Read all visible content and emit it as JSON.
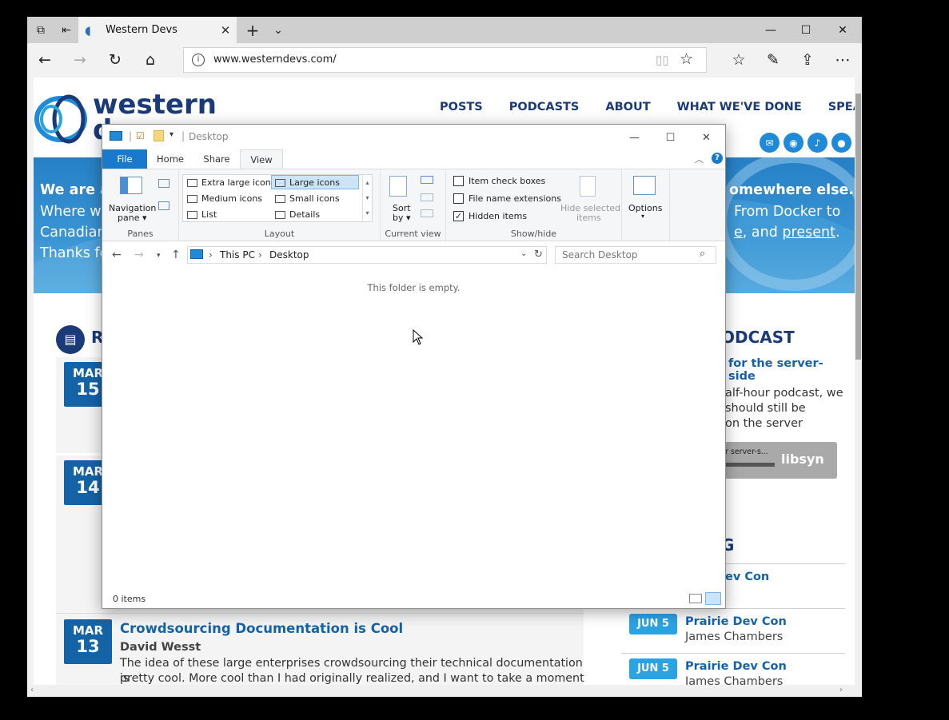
{
  "browser": {
    "tab_title": "Western Devs",
    "url": "www.westerndevs.com/",
    "new_tab": "+",
    "tab_list": "⌄"
  },
  "site": {
    "logo_line1": "western",
    "logo_line2": "devs",
    "menu": [
      "POSTS",
      "PODCASTS",
      "ABOUT",
      "WHAT WE'VE DONE",
      "SPEAKING"
    ],
    "banner": {
      "line1_bold": "We are a",
      "line1_end": "omewhere else.",
      "line2_start": "Where we",
      "line2_end": "From Docker to",
      "line3_start": "Canadian",
      "line3_mid": "e",
      "line3_and": ", and ",
      "line3_link": "present",
      "line3_dot": ".",
      "line4_start": "Thanks for"
    },
    "recent_head": "RE",
    "podcast_head": "ODCAST",
    "podcast_title": "for the server-side",
    "podcast_text": [
      "alf-hour podcast, we",
      "should still be",
      "on the server"
    ],
    "player_label": "r server-s...",
    "player_brand": "libsyn",
    "events_head": "G",
    "posts": [
      {
        "month": "MAR",
        "day": "15"
      },
      {
        "month": "MAR",
        "day": "14"
      },
      {
        "month": "MAR",
        "day": "13",
        "title": "Crowdsourcing Documentation is Cool",
        "author": "David Wesst",
        "body1": "The idea of these large enterprises crowdsourcing their technical documentation is",
        "body2": "pretty cool. More cool than I had originally realized, and I want to take a moment to"
      }
    ],
    "events": [
      {
        "title": "ev Con",
        "sub": ""
      },
      {
        "date": "JUN 5",
        "title": "Prairie Dev Con",
        "sub": "James Chambers"
      },
      {
        "date": "JUN 5",
        "title": "Prairie Dev Con",
        "sub": "James Chambers"
      }
    ]
  },
  "explorer": {
    "title": "Desktop",
    "tabs": {
      "file": "File",
      "home": "Home",
      "share": "Share",
      "view": "View"
    },
    "panes": {
      "nav_pane_1": "Navigation",
      "nav_pane_2": "pane",
      "label": "Panes"
    },
    "layout": {
      "items": [
        "Extra large icons",
        "Large icons",
        "Medium icons",
        "Small icons",
        "List",
        "Details"
      ],
      "selected": "Large icons",
      "label": "Layout"
    },
    "current_view": {
      "sort_1": "Sort",
      "sort_2": "by",
      "label": "Current view"
    },
    "show_hide": {
      "item_check_boxes": "Item check boxes",
      "file_name_extensions": "File name extensions",
      "hidden_items": "Hidden items",
      "hide_selected_1": "Hide selected",
      "hide_selected_2": "items",
      "label": "Show/hide",
      "checked": {
        "item_check_boxes": false,
        "file_name_extensions": false,
        "hidden_items": true
      }
    },
    "options": "Options",
    "path": [
      "This PC",
      "Desktop"
    ],
    "search_placeholder": "Search Desktop",
    "empty_message": "This folder is empty.",
    "status": "0 items"
  }
}
